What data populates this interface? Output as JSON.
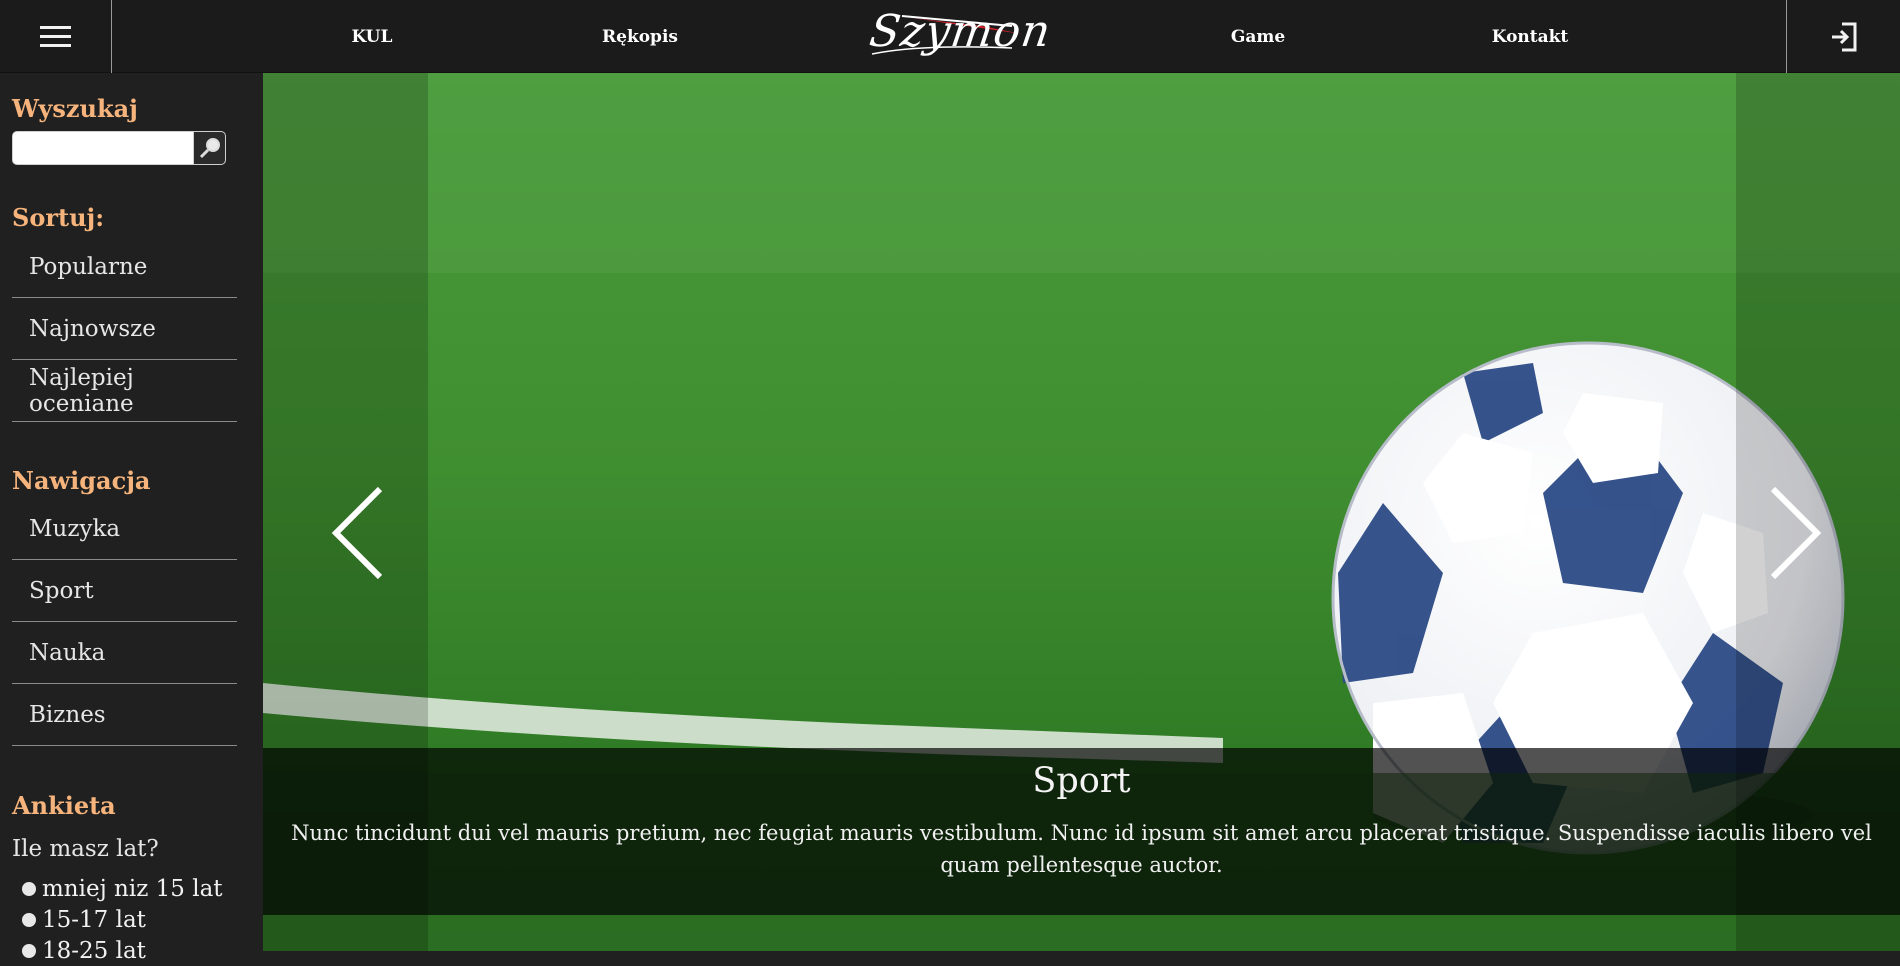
{
  "header": {
    "menu_icon": "hamburger-menu-icon",
    "logo_text": "Szymon",
    "nav": [
      "KUL",
      "Rękopis",
      "Game",
      "Kontakt"
    ],
    "login_icon": "sign-in-icon"
  },
  "sidebar": {
    "search": {
      "heading": "Wyszukaj",
      "value": "",
      "placeholder": "",
      "button_icon": "magnifier-icon"
    },
    "sort": {
      "heading": "Sortuj:",
      "items": [
        "Popularne",
        "Najnowsze",
        "Najlepiej oceniane"
      ]
    },
    "navigation": {
      "heading": "Nawigacja",
      "items": [
        "Muzyka",
        "Sport",
        "Nauka",
        "Biznes"
      ]
    },
    "poll": {
      "heading": "Ankieta",
      "question": "Ile masz lat?",
      "options": [
        "mniej niz 15 lat",
        "15-17 lat",
        "18-25 lat"
      ]
    }
  },
  "carousel": {
    "slide_image": "soccer-ball-on-grass-image",
    "prev_icon": "chevron-left-icon",
    "next_icon": "chevron-right-icon",
    "caption_title": "Sport",
    "caption_text": "Nunc tincidunt dui vel mauris pretium, nec feugiat mauris vestibulum. Nunc id ipsum sit amet arcu placerat tristique. Suspendisse iaculis libero vel quam pellentesque auctor."
  },
  "colors": {
    "topbar": "#1b1b1b",
    "sidebar": "#202020",
    "heading_accent": "#f6b47c",
    "logo_accent": "#d0202a"
  }
}
